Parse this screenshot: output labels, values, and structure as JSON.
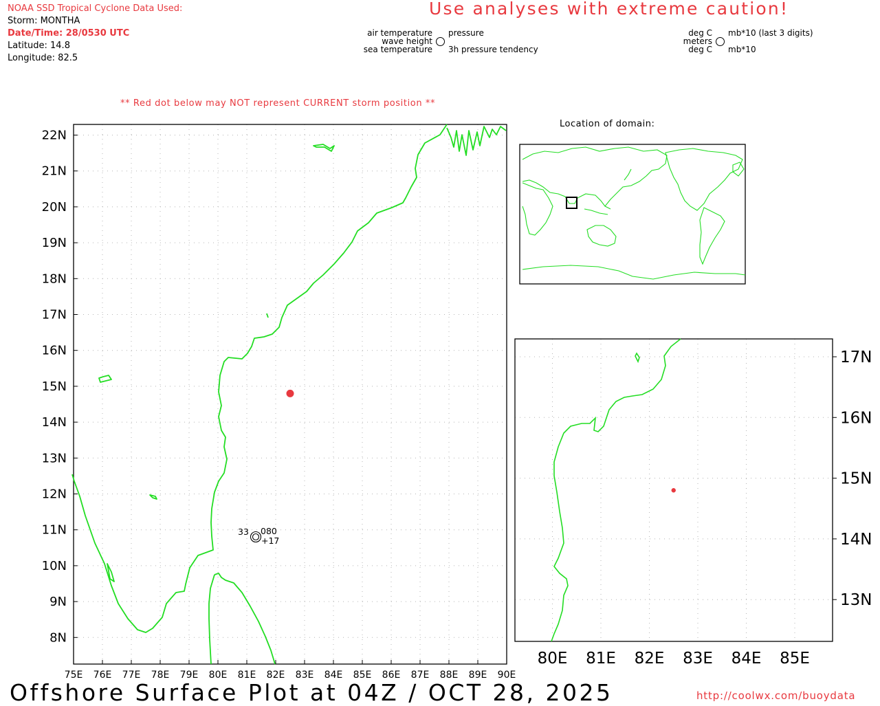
{
  "header": {
    "source": "NOAA SSD Tropical Cyclone Data Used:",
    "storm": "Storm: MONTHA",
    "datetime": "Date/Time: 28/0530 UTC",
    "latitude": "Latitude: 14.8",
    "longitude": "Longitude: 82.5"
  },
  "caution": "Use analyses with extreme caution!",
  "legend": {
    "air_temperature": "air temperature",
    "wave_height": "wave height",
    "sea_temperature": "sea temperature",
    "pressure": "pressure",
    "pressure_tendency": "3h pressure tendency",
    "deg_c_1": "deg C",
    "meters": "meters",
    "deg_c_2": "deg C",
    "mb_last3": "mb*10 (last 3 digits)",
    "mb_2": "mb*10"
  },
  "warning": "** Red dot below may NOT represent CURRENT storm position **",
  "location_title": "Location of domain:",
  "main_map": {
    "lat_labels": [
      "22N",
      "21N",
      "20N",
      "19N",
      "18N",
      "17N",
      "16N",
      "15N",
      "14N",
      "13N",
      "12N",
      "11N",
      "10N",
      "9N",
      "8N"
    ],
    "lon_labels": [
      "75E",
      "76E",
      "77E",
      "78E",
      "79E",
      "80E",
      "81E",
      "82E",
      "83E",
      "84E",
      "85E",
      "86E",
      "87E",
      "88E",
      "89E",
      "90E"
    ],
    "storm": {
      "lat": 14.8,
      "lon": 82.5
    },
    "station": {
      "air_temp": "33",
      "pressure": "080",
      "tendency": "+17"
    }
  },
  "zoom_map": {
    "lat_labels": [
      "17N",
      "16N",
      "15N",
      "14N",
      "13N"
    ],
    "lon_labels": [
      "80E",
      "81E",
      "82E",
      "83E",
      "84E",
      "85E"
    ]
  },
  "footer": {
    "title": "Offshore Surface Plot at 04Z / OCT 28, 2025",
    "url": "http://coolwx.com/buoydata"
  },
  "colors": {
    "coast": "#22dd22",
    "storm": "#e8393f",
    "grid": "#b4b4b4"
  }
}
